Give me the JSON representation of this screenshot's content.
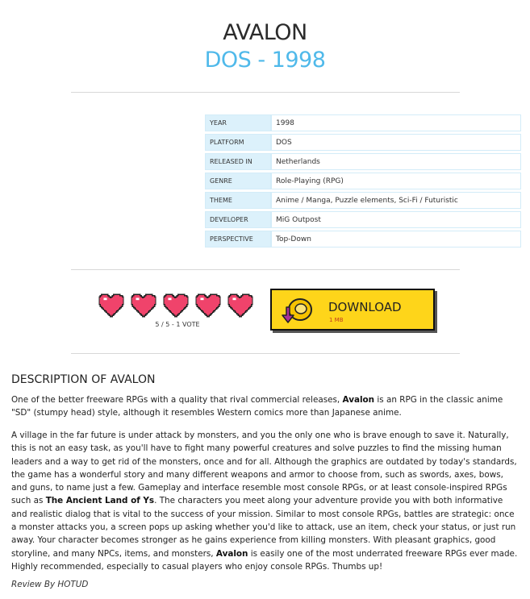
{
  "game": {
    "title": "AVALON",
    "subtitle": "DOS - 1998"
  },
  "info": [
    {
      "key": "YEAR",
      "value": "1998"
    },
    {
      "key": "PLATFORM",
      "value": "DOS"
    },
    {
      "key": "RELEASED IN",
      "value": "Netherlands"
    },
    {
      "key": "GENRE",
      "value": "Role-Playing (RPG)"
    },
    {
      "key": "THEME",
      "value": "Anime / Manga, Puzzle elements, Sci-Fi / Futuristic"
    },
    {
      "key": "DEVELOPER",
      "value": "MiG Outpost"
    },
    {
      "key": "PERSPECTIVE",
      "value": "Top-Down"
    }
  ],
  "rating": {
    "score": 5,
    "max": 5,
    "text": "5 / 5 - 1 VOTE",
    "heart_color": "#f0436b"
  },
  "download": {
    "label": "DOWNLOAD",
    "size": "1 MB",
    "bg_color": "#fed51a"
  },
  "description": {
    "heading": "DESCRIPTION OF AVALON",
    "p1": [
      "One of the better freeware RPGs with a quality that rival commercial releases, ",
      "Avalon",
      " is an RPG in the classic anime \"SD\" (stumpy head) style, although it resembles Western comics more than Japanese anime."
    ],
    "p2": [
      "A village in the far future is under attack by monsters, and you the only one who is brave enough to save it. Naturally, this is not an easy task, as you'll have to fight many powerful creatures and solve puzzles to find the missing human leaders and a way to get rid of the monsters, once and for all. Although the graphics are outdated by today's standards, the game has a wonderful story and many different weapons and armor to choose from, such as swords, axes, bows, and guns, to name just a few. Gameplay and interface resemble most console RPGs, or at least console-inspired RPGs such as ",
      "The Ancient Land of Ys",
      ". The characters you meet along your adventure provide you with both informative and realistic dialog that is vital to the success of your mission. Similar to most console RPGs, battles are strategic: once a monster attacks you, a screen pops up asking whether you'd like to attack, use an item, check your status, or just run away. Your character becomes stronger as he gains experience from killing monsters. With pleasant graphics, good storyline, and many NPCs, items, and monsters, ",
      "Avalon",
      " is easily one of the most underrated freeware RPGs ever made. Highly recommended, especially to casual players who enjoy console RPGs. Thumbs up!"
    ],
    "review": "Review By HOTUD"
  }
}
